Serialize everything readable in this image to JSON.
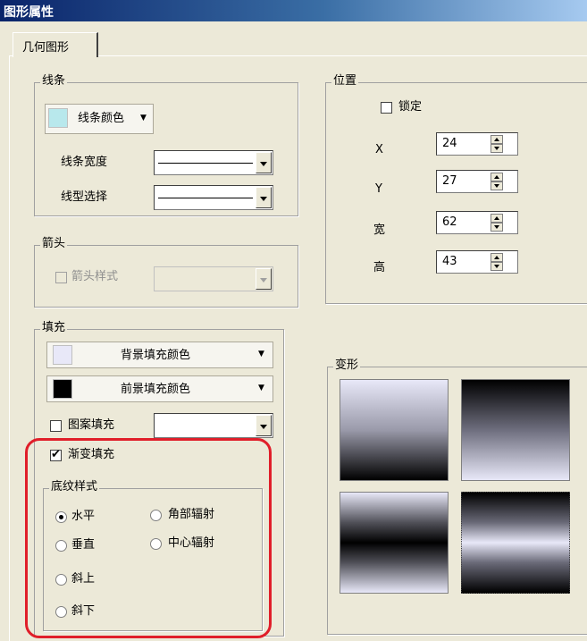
{
  "window": {
    "title": "图形属性"
  },
  "tab": {
    "label": "几何图形"
  },
  "line": {
    "legend": "线条",
    "color_label": "线条颜色",
    "color_swatch": "#b8e8ec",
    "width_label": "线条宽度",
    "style_label": "线型选择"
  },
  "arrow": {
    "legend": "箭头",
    "style_label": "箭头样式"
  },
  "position": {
    "legend": "位置",
    "lock_label": "锁定",
    "x_label": "X",
    "x_value": "24",
    "y_label": "Y",
    "y_value": "27",
    "width_label": "宽",
    "width_value": "62",
    "height_label": "高",
    "height_value": "43"
  },
  "fill": {
    "legend": "填充",
    "bg_label": "背景填充颜色",
    "bg_swatch": "#e8e8f8",
    "fg_label": "前景填充颜色",
    "fg_swatch": "#000000",
    "pattern_label": "图案填充",
    "gradient_label": "渐变填充",
    "gradient_checked": true,
    "texture_legend": "底纹样式",
    "options": {
      "horizontal": "水平",
      "vertical": "垂直",
      "diag_up": "斜上",
      "diag_down": "斜下",
      "corner": "角部辐射",
      "center": "中心辐射"
    },
    "selected": "horizontal"
  },
  "variant": {
    "legend": "变形"
  },
  "colors": {
    "highlight": "#e01e2a",
    "title_start": "#0a246a",
    "title_end": "#a6caf0"
  }
}
